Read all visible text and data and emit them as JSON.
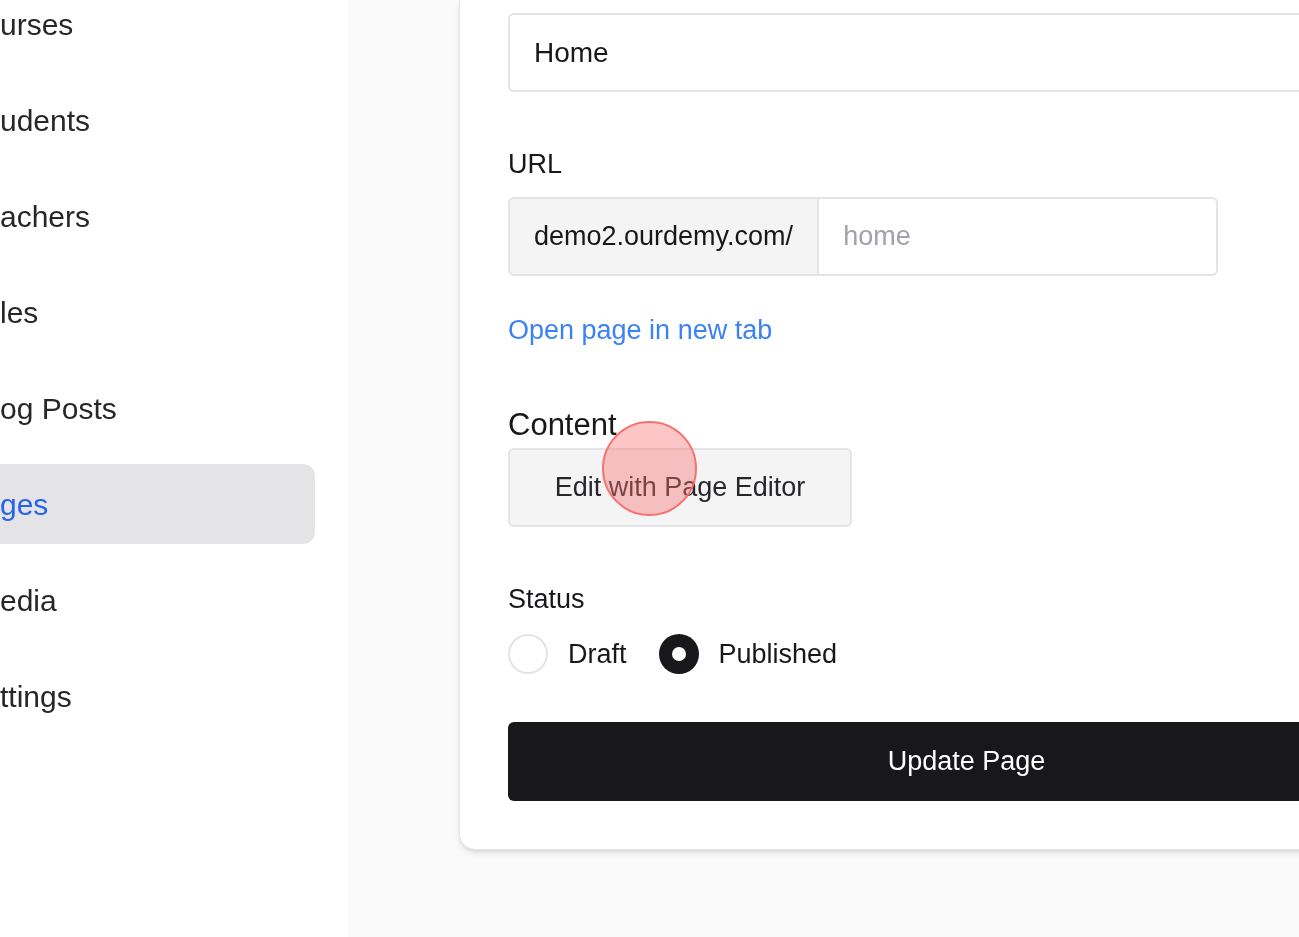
{
  "sidebar": {
    "items": [
      {
        "label": "urses",
        "selected": false
      },
      {
        "label": "udents",
        "selected": false
      },
      {
        "label": "achers",
        "selected": false
      },
      {
        "label": "les",
        "selected": false
      },
      {
        "label": "og Posts",
        "selected": false
      },
      {
        "label": "ges",
        "selected": true
      },
      {
        "label": "edia",
        "selected": false
      },
      {
        "label": "ttings",
        "selected": false
      }
    ]
  },
  "form": {
    "title_field": {
      "value": "Home"
    },
    "url": {
      "label": "URL",
      "prefix": "demo2.ourdemy.com/",
      "placeholder": "home"
    },
    "open_link": "Open page in new tab",
    "content": {
      "label": "Content",
      "button": "Edit with Page Editor"
    },
    "status": {
      "label": "Status",
      "options": [
        {
          "label": "Draft",
          "selected": false
        },
        {
          "label": "Published",
          "selected": true
        }
      ]
    },
    "submit": "Update Page"
  }
}
